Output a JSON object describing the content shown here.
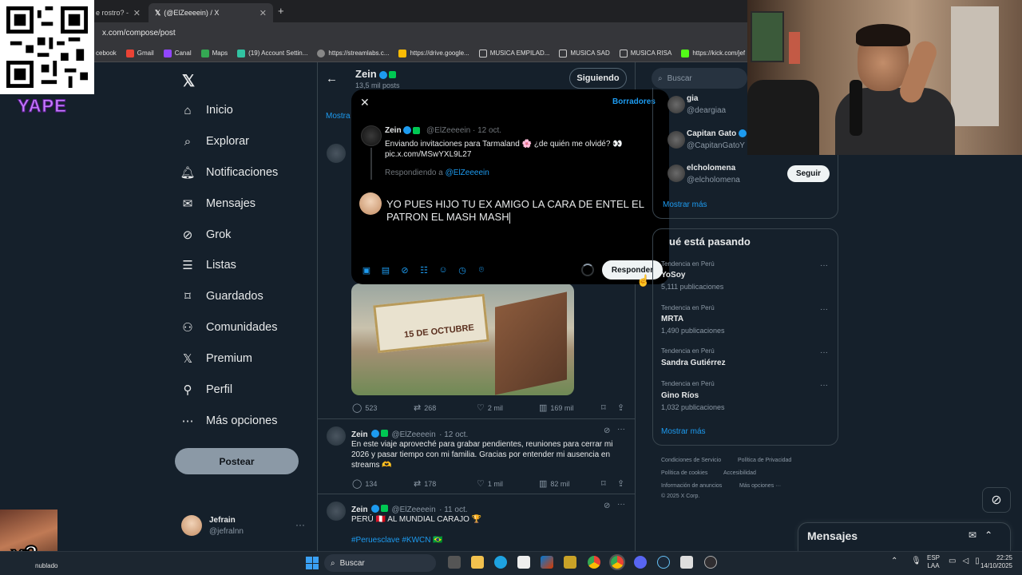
{
  "browser": {
    "tabs": [
      {
        "title": "e rostro? -"
      },
      {
        "title": "(@ElZeeeein) / X"
      }
    ],
    "new_tab": "+",
    "url": "x.com/compose/post",
    "bookmarks": [
      "cebook",
      "Gmail",
      "Canal",
      "Maps",
      "(19) Account Settin...",
      "https://streamlabs.c...",
      "https://drive.google...",
      "MUSICA EMPILAD...",
      "MUSICA SAD",
      "MUSICA RISA",
      "https://kick.com/jef"
    ]
  },
  "overlay": {
    "yape": "YAPE",
    "multiplier": "x3"
  },
  "nav": {
    "items": [
      {
        "label": "Inicio",
        "icon": "home-icon"
      },
      {
        "label": "Explorar",
        "icon": "search-icon"
      },
      {
        "label": "Notificaciones",
        "icon": "bell-icon"
      },
      {
        "label": "Mensajes",
        "icon": "mail-icon"
      },
      {
        "label": "Grok",
        "icon": "grok-icon"
      },
      {
        "label": "Listas",
        "icon": "list-icon"
      },
      {
        "label": "Guardados",
        "icon": "bookmark-icon"
      },
      {
        "label": "Comunidades",
        "icon": "people-icon"
      },
      {
        "label": "Premium",
        "icon": "x-icon"
      },
      {
        "label": "Perfil",
        "icon": "person-icon"
      },
      {
        "label": "Más opciones",
        "icon": "more-circle-icon"
      }
    ],
    "post_button": "Postear",
    "user": {
      "name": "Jefrain",
      "handle": "@jefralnn",
      "more": "···"
    }
  },
  "profile_header": {
    "name": "Zein",
    "posts": "13,5 mil posts",
    "follow_state": "Siguiendo",
    "tab_partial": "Mostra"
  },
  "feed": {
    "tweet1_actions": {
      "replies": "523",
      "retweets": "268",
      "likes": "2 mil",
      "views": "169 mil"
    },
    "image_text": "15 DE OCTUBRE",
    "tweet2": {
      "name": "Zein",
      "handle": "@ElZeeeein",
      "date": "· 12 oct.",
      "body": "En este viaje aproveché para grabar pendientes, reuniones para cerrar mi 2026 y pasar tiempo con mi familia. Gracias por entender mi ausencia en streams 🫶",
      "replies": "134",
      "retweets": "178",
      "likes": "1 mil",
      "views": "82 mil"
    },
    "tweet3": {
      "name": "Zein",
      "handle": "@ElZeeeein",
      "date": "· 11 oct.",
      "body": "PERÚ 🇵🇪 AL MUNDIAL CARAJO 🏆",
      "hashtags": "#Peruesclave #KWCN 🇧🇷"
    }
  },
  "compose_modal": {
    "drafts": "Borradores",
    "original": {
      "name": "Zein",
      "handle": "@ElZeeeein · 12 oct.",
      "text": "Enviando invitaciones para Tarmaland 🌸 ¿de quién me olvidé? 👀 pic.x.com/MSwYXL9L27",
      "replying_prefix": "Respondiendo a",
      "replying_handle": "@ElZeeeein"
    },
    "reply_text": "YO PUES HIJO TU EX AMIGO LA CARA DE ENTEL EL PATRON EL MASH MASH",
    "reply_button": "Responder",
    "tools": [
      "image-icon",
      "gif-icon",
      "grok-icon",
      "poll-icon",
      "emoji-icon",
      "schedule-icon",
      "location-icon"
    ]
  },
  "right": {
    "search_placeholder": "Buscar",
    "who_to_follow": [
      {
        "name": "gia",
        "handle": "@deargiaa"
      },
      {
        "name": "Capitan Gato",
        "handle": "@CapitanGatoY"
      },
      {
        "name": "elcholomena",
        "handle": "@elcholomena"
      }
    ],
    "follow_button": "Seguir",
    "show_more": "Mostrar más",
    "trends_title": "ué está pasando",
    "trends": [
      {
        "context": "Tendencia en Perú",
        "name": "YoSoy",
        "count": "5,111 publicaciones"
      },
      {
        "context": "Tendencia en Perú",
        "name": "MRTA",
        "count": "1,490 publicaciones"
      },
      {
        "context": "Tendencia en Perú",
        "name": "Sandra Gutiérrez",
        "count": ""
      },
      {
        "context": "Tendencia en Perú",
        "name": "Gino Ríos",
        "count": "1,032 publicaciones"
      }
    ],
    "trends_more": "Mostrar más",
    "footer": [
      "Condiciones de Servicio",
      "Política de Privacidad",
      "Política de cookies",
      "Accesibilidad",
      "Información de anuncios",
      "Más opciones ···",
      "© 2025 X Corp."
    ],
    "messages_dock": "Mensajes"
  },
  "taskbar": {
    "weather": "nublado",
    "search": "Buscar",
    "lang1": "ESP",
    "lang2": "LAA",
    "time": "22:25",
    "date": "14/10/2025"
  }
}
